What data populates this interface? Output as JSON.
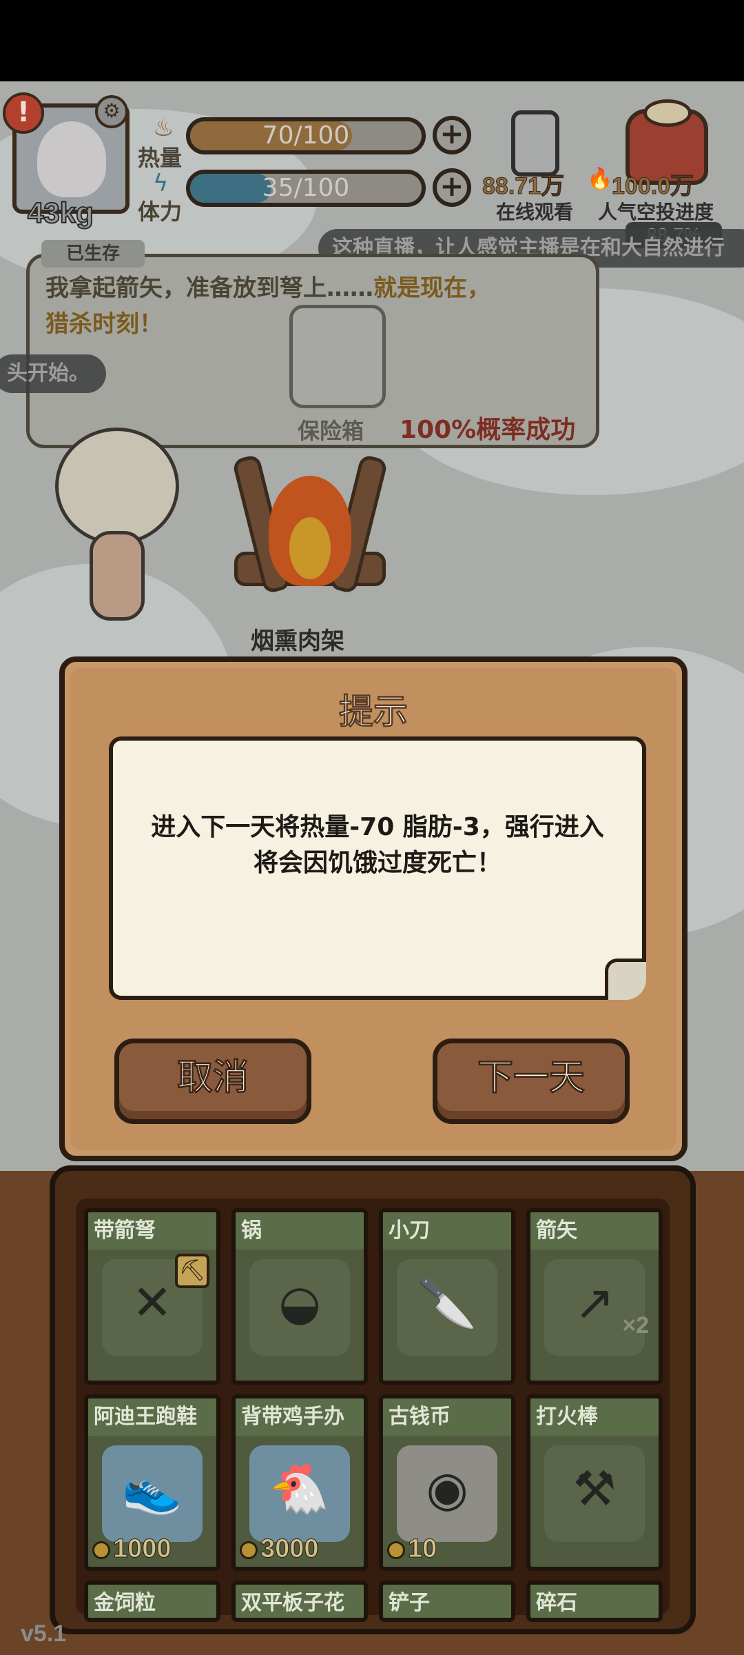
{
  "hud": {
    "weight": "43kg",
    "alert": "!",
    "heat_label": "热量",
    "heat_value": "70/100",
    "heat_progress": 0.7,
    "stamina_label": "体力",
    "stamina_value": "35/100",
    "stamina_progress": 0.35,
    "plus": "+",
    "viewers": "88.71万",
    "popularity": "100.0万",
    "viewers_caption": "在线观看",
    "airdrop_caption": "人气空投进度",
    "airdrop_pct": "88.7%"
  },
  "danmaku": [
    "这种直播，让人感觉主播是在和大自然进行",
    "头开始。"
  ],
  "speech": {
    "speaker": "已生存",
    "line1": "我拿起箭矢，准备放到弩上……",
    "line1_highlight": "就是现在，",
    "line2": "猎杀时刻！",
    "safe_label": "保险箱",
    "success_text": "100%概率成功"
  },
  "campfire_label": "烟熏肉架",
  "dialog": {
    "title": "提示",
    "message_line1": "进入下一天将热量-70 脂肪-3，强行进入",
    "message_line2": "将会因饥饿过度死亡！",
    "cancel_label": "取消",
    "next_label": "下一天"
  },
  "inventory": {
    "row1": [
      {
        "name": "带箭弩",
        "glyph": "✕"
      },
      {
        "name": "锅",
        "glyph": "◒"
      },
      {
        "name": "小刀",
        "glyph": "🔪"
      },
      {
        "name": "箭矢",
        "glyph": "↗",
        "count": "×2"
      }
    ],
    "row2": [
      {
        "name": "阿迪王跑鞋",
        "glyph": "👟",
        "price": "1000"
      },
      {
        "name": "背带鸡手办",
        "glyph": "🐔",
        "price": "3000"
      },
      {
        "name": "古钱币",
        "glyph": "◉",
        "price": "10"
      },
      {
        "name": "打火棒",
        "glyph": "⚒"
      }
    ],
    "row3": [
      {
        "name": "金饲粒"
      },
      {
        "name": "双平板子花"
      },
      {
        "name": "铲子"
      },
      {
        "name": "碎石"
      }
    ]
  },
  "version": "v5.1"
}
